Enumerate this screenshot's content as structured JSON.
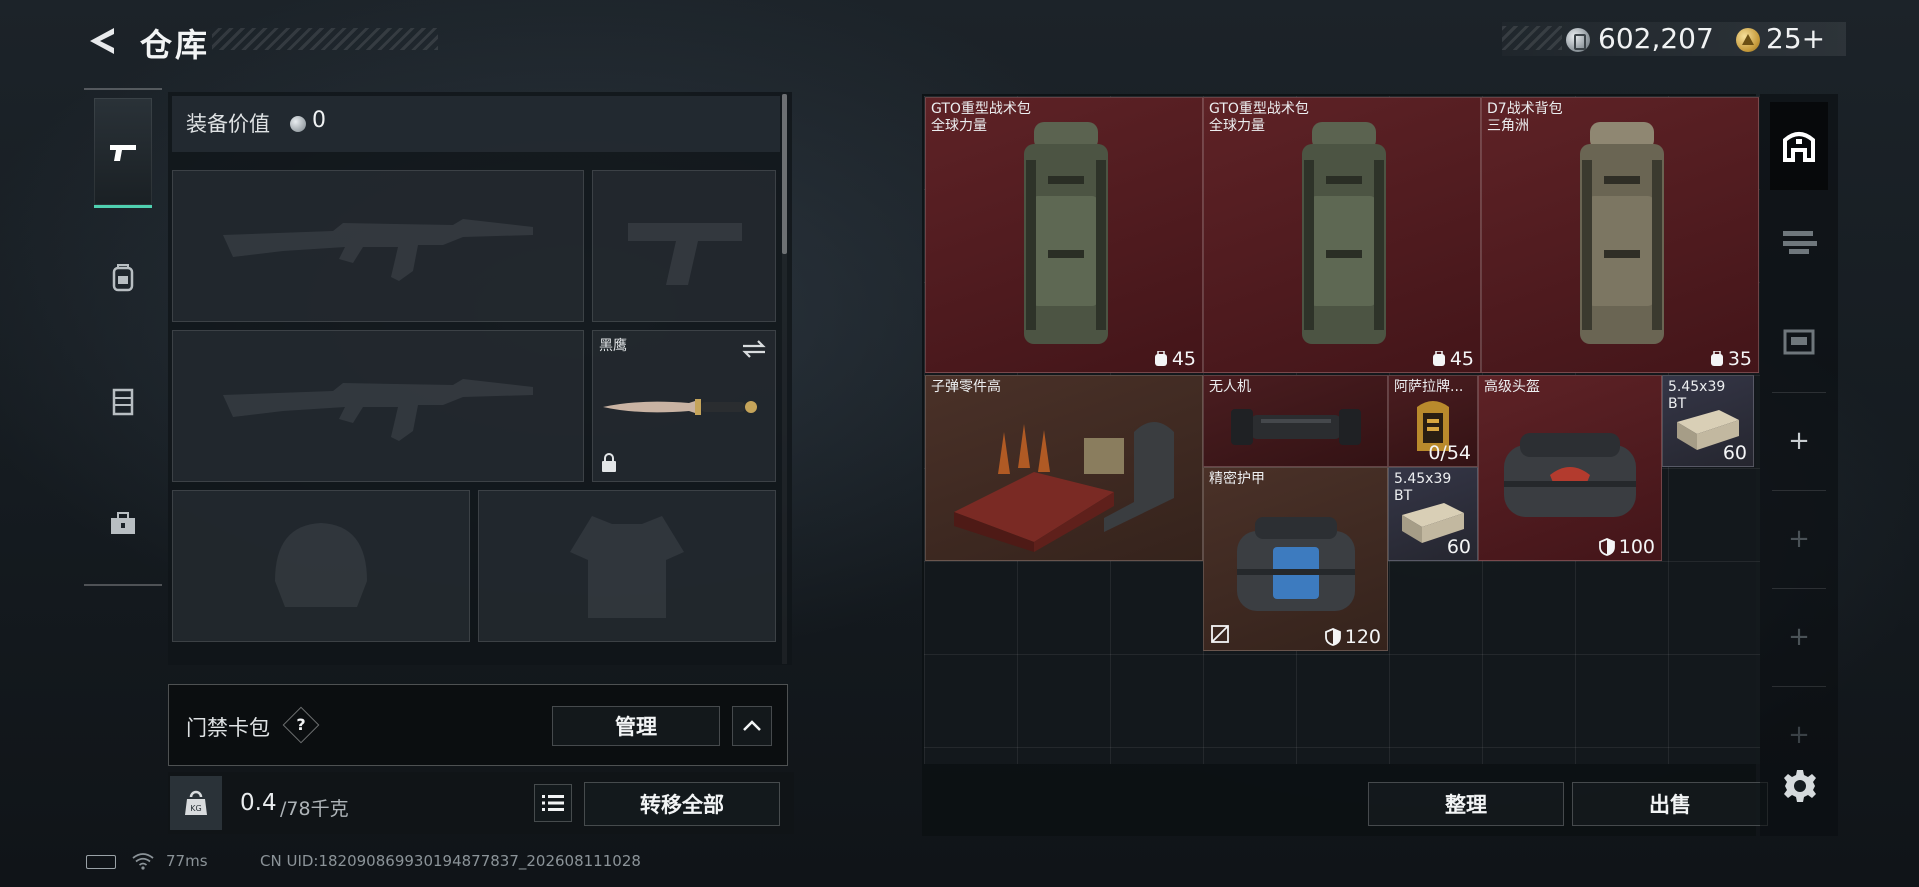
{
  "header": {
    "title": "仓库",
    "money": "602,207",
    "premium": "25+"
  },
  "loadout": {
    "value_label": "装备价值",
    "value_amount": "0",
    "knife_slot_label": "黑鹰",
    "keycard_label": "门禁卡包",
    "help_symbol": "?",
    "manage_label": "管理",
    "weight_value": "0.4",
    "weight_max": "/78千克",
    "transfer_all_label": "转移全部"
  },
  "status": {
    "ping": "77ms",
    "uid": "CN UID:182090869930194877837_202608111028"
  },
  "stash": {
    "items": [
      {
        "name": "GTO重型战术包",
        "sub": "全球力量",
        "stat": "45"
      },
      {
        "name": "GTO重型战术包",
        "sub": "全球力量",
        "stat": "45"
      },
      {
        "name": "D7战术背包",
        "sub": "三角洲",
        "stat": "35"
      },
      {
        "name": "子弹零件高",
        "sub": "",
        "stat": ""
      },
      {
        "name": "无人机",
        "sub": "",
        "stat": ""
      },
      {
        "name": "阿萨拉牌...",
        "sub": "",
        "stat": "0/54"
      },
      {
        "name": "高级头盔",
        "sub": "",
        "stat": "100"
      },
      {
        "name": "5.45x39",
        "sub": "BT",
        "stat": "60"
      },
      {
        "name": "精密护甲",
        "sub": "",
        "stat": "120"
      },
      {
        "name": "5.45x39",
        "sub": "BT",
        "stat": "60"
      }
    ],
    "sort_label": "整理",
    "sell_label": "出售"
  },
  "icons": {
    "back": "back-arrow-icon",
    "currency": "silver-coin-icon",
    "premium": "gold-coin-icon",
    "rail": [
      "pistol-icon",
      "backpack-icon",
      "vest-icon",
      "toolbox-icon"
    ],
    "stash_tabs": [
      "stash-home-icon",
      "weapon-rack-icon",
      "storage-box-icon"
    ],
    "settings": "gear-icon"
  },
  "colors": {
    "accent": "#4fd0b0",
    "rare_red": "#5e2226",
    "epic_brown": "#4a3128",
    "common_navy": "#353647"
  }
}
